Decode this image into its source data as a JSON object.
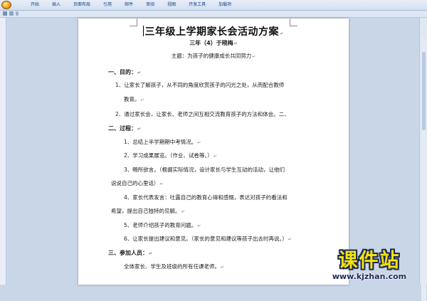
{
  "ribbon": {
    "tabs": [
      "开始",
      "插入",
      "页面布局",
      "引用",
      "邮件",
      "审阅",
      "视图",
      "开发工具",
      "加载项"
    ]
  },
  "document": {
    "title": "三年级上学期家长会活动方案",
    "author": "三年（4）于晓梅",
    "theme": "主题：为孩子的健康成长共同努力",
    "section1_heading": "一、目的：",
    "s1_item1_a": "1、让家长了解孩子，从不同的角度欣赏孩子的闪光之处，从而配合教师",
    "s1_item1_b": "教育。",
    "s1_item2": "2、通过家长会，让家长、老师之间互相交流教育孩子的方法和体会。二、",
    "section2_heading": "二、过程：",
    "s2_item1": "1、总结上半学期期中考情况。",
    "s2_item2": "2、学习成果展览。（作业、试卷等。）",
    "s2_item3_a": "3、畅所欲言。（根据实际情况，设计家长与学生互动的活动，让他们",
    "s2_item3_b": "说说自己的心里话）",
    "s2_item4_a": "4、家长代表发言：吐露自己的教育心得和感慨，表达对孩子的看法和",
    "s2_item4_b": "希望，提出自己独特的见解。",
    "s2_item5": "5、老师介绍孩子的教育问题。",
    "s2_item6": "6、让家长提出建议和意见。（家长的意见和建议等孩子出去时再说。）",
    "section3_heading": "三、参加人员：",
    "s3_item1": "全体家长、学生及班级的所有任课老师。",
    "para_mark": "↵"
  },
  "watermark": {
    "name": "课件站",
    "url": "www.kjzhan.com"
  },
  "colors": {
    "ribbon_text": "#15428b",
    "watermark_fill": "#f2e30c",
    "watermark_outline": "#1f2a55"
  }
}
